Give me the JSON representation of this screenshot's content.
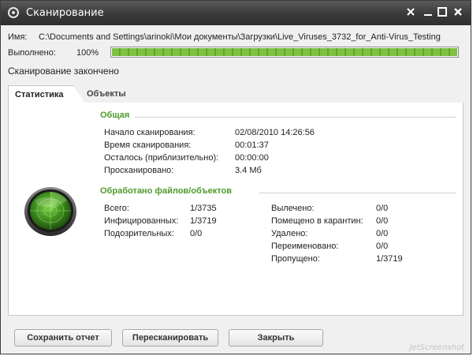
{
  "window": {
    "title": "Сканирование",
    "minimize_glyph": "✕",
    "restore_glyph": "▁",
    "maximize_glyph": "□",
    "close_glyph": "✕"
  },
  "header": {
    "name_label": "Имя:",
    "name_value": "C:\\Documents and Settings\\arinoki\\Мои документы\\Загрузки\\Live_Viruses_3732_for_Anti-Virus_Testing",
    "done_label": "Выполнено:",
    "done_value": "100%",
    "progress_fraction": 1.0,
    "status": "Сканирование закончено"
  },
  "tabs": [
    {
      "label": "Статистика",
      "active": true
    },
    {
      "label": "Объекты",
      "active": false
    }
  ],
  "general": {
    "heading": "Общая",
    "rows": [
      {
        "label": "Начало сканирования:",
        "value": "02/08/2010 14:26:56"
      },
      {
        "label": "Время сканирования:",
        "value": "00:01:37"
      },
      {
        "label": "Осталось (приблизительно):",
        "value": "00:00:00"
      },
      {
        "label": "Просканировано:",
        "value": "3.4 Мб"
      }
    ]
  },
  "processed": {
    "heading": "Обработано файлов/объектов",
    "left": [
      {
        "label": "Всего:",
        "value": "1/3735"
      },
      {
        "label": "Инфицированных:",
        "value": "1/3719"
      },
      {
        "label": "Подозрительных:",
        "value": "0/0"
      }
    ],
    "right": [
      {
        "label": "Вылечено:",
        "value": "0/0"
      },
      {
        "label": "Помещено в карантин:",
        "value": "0/0"
      },
      {
        "label": "Удалено:",
        "value": "0/0"
      },
      {
        "label": "Переименовано:",
        "value": "0/0"
      },
      {
        "label": "Пропущено:",
        "value": "1/3719"
      }
    ]
  },
  "buttons": {
    "save_report": "Сохранить отчет",
    "rescan": "Пересканировать",
    "close": "Закрыть"
  },
  "watermark": "JetScreenshot",
  "colors": {
    "accent": "#4e9a2a",
    "progress": "#7fc043",
    "titlebar": "#3a3a3a"
  }
}
